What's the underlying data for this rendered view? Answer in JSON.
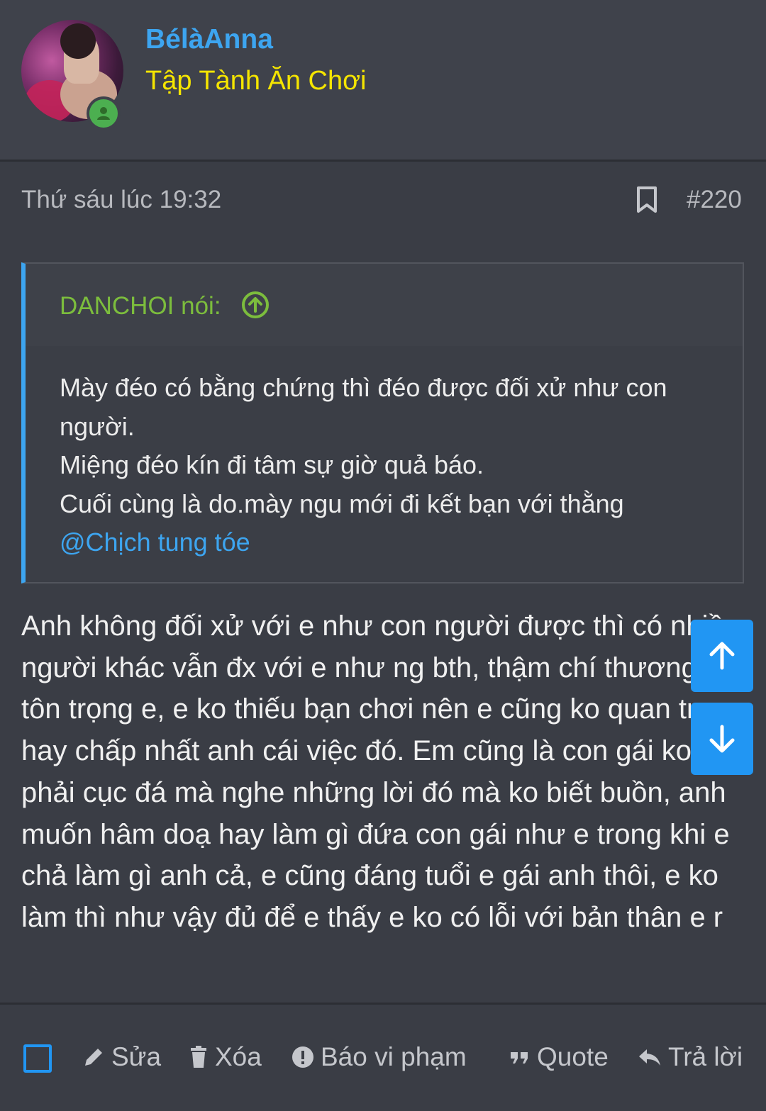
{
  "user": {
    "name": "BélàAnna",
    "title": "Tập Tành Ăn Chơi",
    "avatar_icon": "user-avatar",
    "online_icon": "online-user-icon"
  },
  "post_meta": {
    "date": "Thứ sáu lúc 19:32",
    "number": "#220"
  },
  "quote": {
    "author": "DANCHOI nói:",
    "lines": [
      "Mày đéo có bằng chứng thì đéo được đối xử như con người.",
      "Miệng đéo kín đi tâm sự giờ quả báo.",
      "Cuối cùng là do.mày ngu mới đi kết bạn với thằng"
    ],
    "mention": "@Chịch tung tóe"
  },
  "post_body": "Anh không đối xử với e như con người được thì có nhiều người khác vẫn đx với e như ng bth, thậm chí thương và tôn trọng e, e ko thiếu bạn chơi nên e cũng ko quan trọng hay chấp nhất anh cái việc đó. Em cũng là con gái ko phải cục đá mà nghe những lời đó mà ko biết buồn, anh muốn hâm doạ hay làm gì đứa con gái như e trong khi e chả làm gì anh cả, e cũng đáng tuổi e gái anh thôi, e ko làm thì như vậy đủ để e thấy e ko có lỗi với bản thân e r",
  "actions": {
    "edit": "Sửa",
    "delete": "Xóa",
    "report": "Báo vi phạm",
    "quote": "Quote",
    "reply": "Trả lời"
  },
  "colors": {
    "background": "#3a3d45",
    "username": "#3da5f0",
    "usertitle": "#f5e500",
    "quote_author": "#7cbd3d",
    "accent": "#2196f3"
  }
}
